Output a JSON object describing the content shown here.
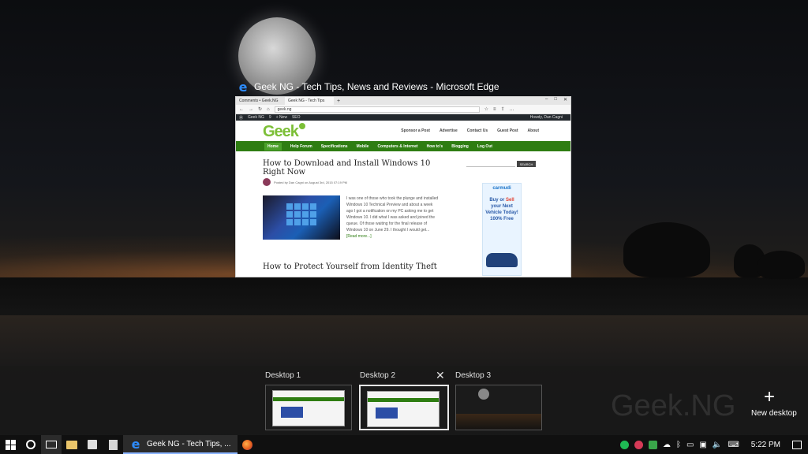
{
  "window_title": "Geek NG - Tech Tips, News and Reviews - Microsoft Edge",
  "browser": {
    "tabs": [
      "Comments • Geek.NG",
      "Geek NG - Tech Tips"
    ],
    "address": "geek.ng",
    "wp_bar": [
      "Geek NG",
      "9",
      "+ New",
      "SEO"
    ],
    "wp_user": "Howdy, Dan Cagni"
  },
  "site": {
    "logo": "Geek",
    "menu": [
      "Sponsor a Post",
      "Advertise",
      "Contact Us",
      "Guest Post",
      "About"
    ],
    "nav": [
      "Home",
      "Help Forum",
      "Specifications",
      "Mobile",
      "Computers & Internet",
      "How to's",
      "Blogging",
      "Log Out"
    ],
    "post1_title": "How to Download and Install Windows 10 Right Now",
    "post1_meta": "Posted by Dan Cagni on August 3rd, 2015 07:19 PM",
    "post1_excerpt": "I was one of those who took the plunge and installed Windows 10 Technical Preview and about a week ago I got a notification on my PC asking me to get Windows 10. I did what I was asked and joined the queue. Of those waiting for the final release of Windows 10 on June 29. I thought I would get...",
    "read_more": "[Read more...]",
    "post2_title": "How to Protect Yourself from Identity Theft",
    "search_label": "SEARCH",
    "ad": {
      "brand": "carmudi",
      "line1": "Buy or",
      "sell": "Sell",
      "line2": "your Next Vehicle Today! 100% Free"
    }
  },
  "desktops": [
    {
      "label": "Desktop 1"
    },
    {
      "label": "Desktop 2"
    },
    {
      "label": "Desktop 3"
    }
  ],
  "new_desktop_label": "New desktop",
  "watermark": "Geek.NG",
  "taskbar": {
    "app_label": "Geek NG - Tech Tips, ...",
    "clock": "5:22 PM"
  }
}
